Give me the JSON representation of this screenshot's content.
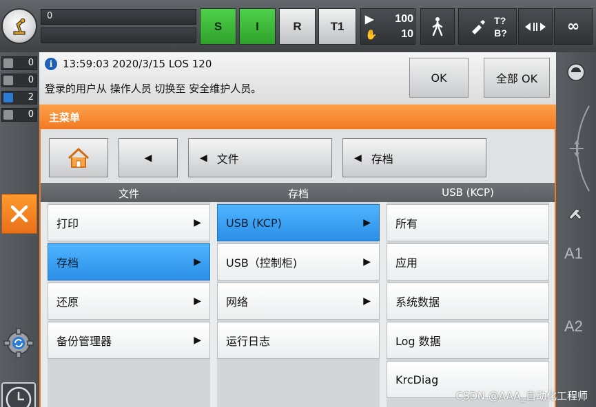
{
  "topbar": {
    "status_top": "0",
    "status_bottom": "",
    "btn_s": "S",
    "btn_i": "I",
    "btn_r": "R",
    "btn_t1": "T1",
    "speed_override": "100",
    "jog_override": "10",
    "tool_label_t": "T?",
    "tool_label_b": "B?",
    "infinity": "∞"
  },
  "left": {
    "counters": [
      {
        "value": "0",
        "color": "#8d9296"
      },
      {
        "value": "0",
        "color": "#8d9296"
      },
      {
        "value": "2",
        "color": "#2a7ad6"
      },
      {
        "value": "0",
        "color": "#8d9296"
      }
    ]
  },
  "message": {
    "header": "13:59:03 2020/3/15 LOS 120",
    "text": "登录的用户从 操作人员 切换至 安全维护人员。",
    "ok_label": "OK",
    "all_ok_label": "全部 OK"
  },
  "right": {
    "a1": "A1",
    "a2": "A2"
  },
  "menu": {
    "title": "主菜单",
    "nav": {
      "back_file": "文件",
      "back_archive": "存档"
    },
    "columns": [
      {
        "header": "文件",
        "items": [
          {
            "label": "打印",
            "arrow": true,
            "selected": false
          },
          {
            "label": "存档",
            "arrow": true,
            "selected": true
          },
          {
            "label": "还原",
            "arrow": true,
            "selected": false
          },
          {
            "label": "备份管理器",
            "arrow": true,
            "selected": false
          }
        ]
      },
      {
        "header": "存档",
        "items": [
          {
            "label": "USB (KCP)",
            "arrow": true,
            "selected": true
          },
          {
            "label": "USB（控制柜)",
            "arrow": true,
            "selected": false
          },
          {
            "label": "网络",
            "arrow": true,
            "selected": false
          },
          {
            "label": "运行日志",
            "arrow": false,
            "selected": false
          }
        ]
      },
      {
        "header": "USB (KCP)",
        "items": [
          {
            "label": "所有",
            "arrow": false,
            "selected": false
          },
          {
            "label": "应用",
            "arrow": false,
            "selected": false
          },
          {
            "label": "系统数据",
            "arrow": false,
            "selected": false
          },
          {
            "label": "Log 数据",
            "arrow": false,
            "selected": false
          },
          {
            "label": "KrcDiag",
            "arrow": false,
            "selected": false
          }
        ]
      }
    ]
  },
  "watermark": "CSDN @AAA_自动化工程师"
}
